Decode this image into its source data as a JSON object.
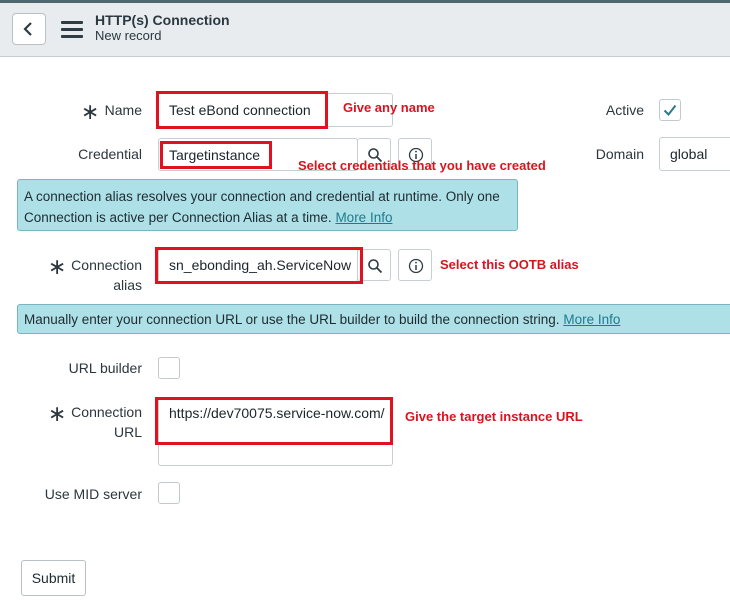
{
  "header": {
    "title": "HTTP(s) Connection",
    "subtitle": "New record"
  },
  "form": {
    "name": {
      "label": "Name",
      "value": "Test eBond connection"
    },
    "active": {
      "label": "Active",
      "checked": true
    },
    "credential": {
      "label": "Credential",
      "value": "Targetinstance"
    },
    "domain": {
      "label": "Domain",
      "value": "global"
    },
    "alias_info": {
      "text": "A connection alias resolves your connection and credential at runtime. Only one Connection is active per Connection Alias at a time.",
      "link": "More Info"
    },
    "connection_alias": {
      "label_line1": "Connection",
      "label_line2": "alias",
      "value": "sn_ebonding_ah.ServiceNow"
    },
    "url_info": {
      "text": "Manually enter your connection URL or use the URL builder to build the connection string.",
      "link": "More Info"
    },
    "url_builder": {
      "label": "URL builder",
      "checked": false
    },
    "connection_url": {
      "label_line1": "Connection",
      "label_line2": "URL",
      "value": "https://dev70075.service-now.com/"
    },
    "use_mid_server": {
      "label": "Use MID server",
      "checked": false
    },
    "required_mark": "∗",
    "submit_label": "Submit"
  },
  "annotations": {
    "name": "Give any name",
    "credential": "Select credentials that you have created",
    "alias": "Select this OOTB alias",
    "url": "Give the target instance URL",
    "color": "#d9141f"
  },
  "icons": {
    "back": "chevron-left-icon",
    "menu": "hamburger-menu-icon",
    "search": "magnifier-icon",
    "info": "info-circle-icon",
    "check": "checkmark-icon"
  }
}
